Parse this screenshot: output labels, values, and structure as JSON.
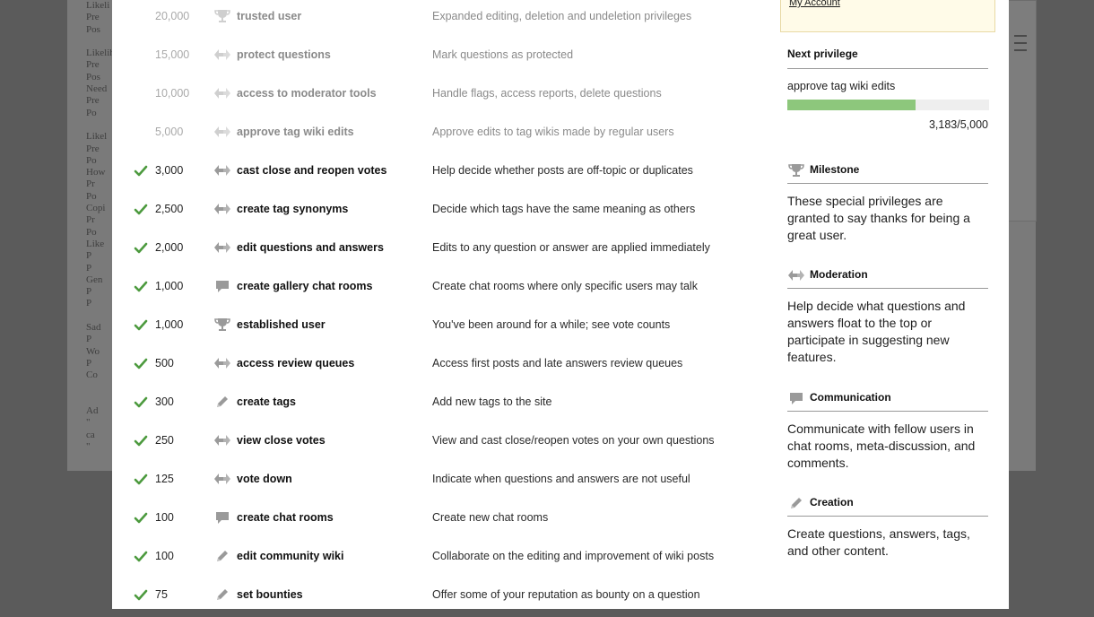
{
  "account": {
    "link_label": "My Account"
  },
  "privileges": [
    {
      "rep": "20,000",
      "name": "trusted user",
      "desc": "Expanded editing, deletion and undeletion privileges",
      "earned": false,
      "icon": "trophy-icon"
    },
    {
      "rep": "15,000",
      "name": "protect questions",
      "desc": "Mark questions as protected",
      "earned": false,
      "icon": "moderation-icon"
    },
    {
      "rep": "10,000",
      "name": "access to moderator tools",
      "desc": "Handle flags, access reports, delete questions",
      "earned": false,
      "icon": "moderation-icon"
    },
    {
      "rep": "5,000",
      "name": "approve tag wiki edits",
      "desc": "Approve edits to tag wikis made by regular users",
      "earned": false,
      "icon": "moderation-icon"
    },
    {
      "rep": "3,000",
      "name": "cast close and reopen votes",
      "desc": "Help decide whether posts are off-topic or duplicates",
      "earned": true,
      "icon": "moderation-icon"
    },
    {
      "rep": "2,500",
      "name": "create tag synonyms",
      "desc": "Decide which tags have the same meaning as others",
      "earned": true,
      "icon": "moderation-icon"
    },
    {
      "rep": "2,000",
      "name": "edit questions and answers",
      "desc": "Edits to any question or answer are applied immediately",
      "earned": true,
      "icon": "moderation-icon"
    },
    {
      "rep": "1,000",
      "name": "create gallery chat rooms",
      "desc": "Create chat rooms where only specific users may talk",
      "earned": true,
      "icon": "chat-bubble-icon"
    },
    {
      "rep": "1,000",
      "name": "established user",
      "desc": "You've been around for a while; see vote counts",
      "earned": true,
      "icon": "trophy-icon"
    },
    {
      "rep": "500",
      "name": "access review queues",
      "desc": "Access first posts and late answers review queues",
      "earned": true,
      "icon": "moderation-icon"
    },
    {
      "rep": "300",
      "name": "create tags",
      "desc": "Add new tags to the site",
      "earned": true,
      "icon": "pencil-icon"
    },
    {
      "rep": "250",
      "name": "view close votes",
      "desc": "View and cast close/reopen votes on your own questions",
      "earned": true,
      "icon": "moderation-icon"
    },
    {
      "rep": "125",
      "name": "vote down",
      "desc": "Indicate when questions and answers are not useful",
      "earned": true,
      "icon": "moderation-icon"
    },
    {
      "rep": "100",
      "name": "create chat rooms",
      "desc": "Create new chat rooms",
      "earned": true,
      "icon": "chat-bubble-icon"
    },
    {
      "rep": "100",
      "name": "edit community wiki",
      "desc": "Collaborate on the editing and improvement of wiki posts",
      "earned": true,
      "icon": "pencil-icon"
    },
    {
      "rep": "75",
      "name": "set bounties",
      "desc": "Offer some of your reputation as bounty on a question",
      "earned": true,
      "icon": "pencil-icon"
    }
  ],
  "next_privilege": {
    "heading": "Next privilege",
    "name": "approve tag wiki edits",
    "progress_text": "3,183/5,000",
    "progress_fraction": 0.6366
  },
  "categories": [
    {
      "title": "Milestone",
      "icon": "trophy-icon",
      "text": "These special privileges are granted to say thanks for being a great user."
    },
    {
      "title": "Moderation",
      "icon": "moderation-icon",
      "text": "Help decide what questions and answers float to the top or participate in suggesting new features."
    },
    {
      "title": "Communication",
      "icon": "chat-bubble-icon",
      "text": "Communicate with fellow users in chat rooms, meta-discussion, and comments."
    },
    {
      "title": "Creation",
      "icon": "pencil-icon",
      "text": "Create questions, answers, tags, and other content."
    }
  ],
  "background_text": {
    "lines": [
      "Likeli",
      "Pre",
      "Pos",
      "",
      "Likelih",
      "Pre",
      "Pos",
      "Need",
      "Pre",
      "Po",
      "",
      "Likel",
      "Pre",
      "Po",
      "How",
      "Pr",
      "Po",
      "Copi",
      "Pr",
      "Po",
      "Like",
      "P",
      "P",
      "Gen",
      "P",
      "P",
      "",
      "Sad",
      "P",
      "Wo",
      "P",
      "Co",
      "",
      "",
      "Ad",
      "\"",
      "ca",
      "\""
    ]
  },
  "colors": {
    "earned_check": "#4c9a3e",
    "progress_fill": "#8dc77c",
    "icon_grey": "#9a9a9a",
    "icon_light": "#cfcfcf"
  }
}
